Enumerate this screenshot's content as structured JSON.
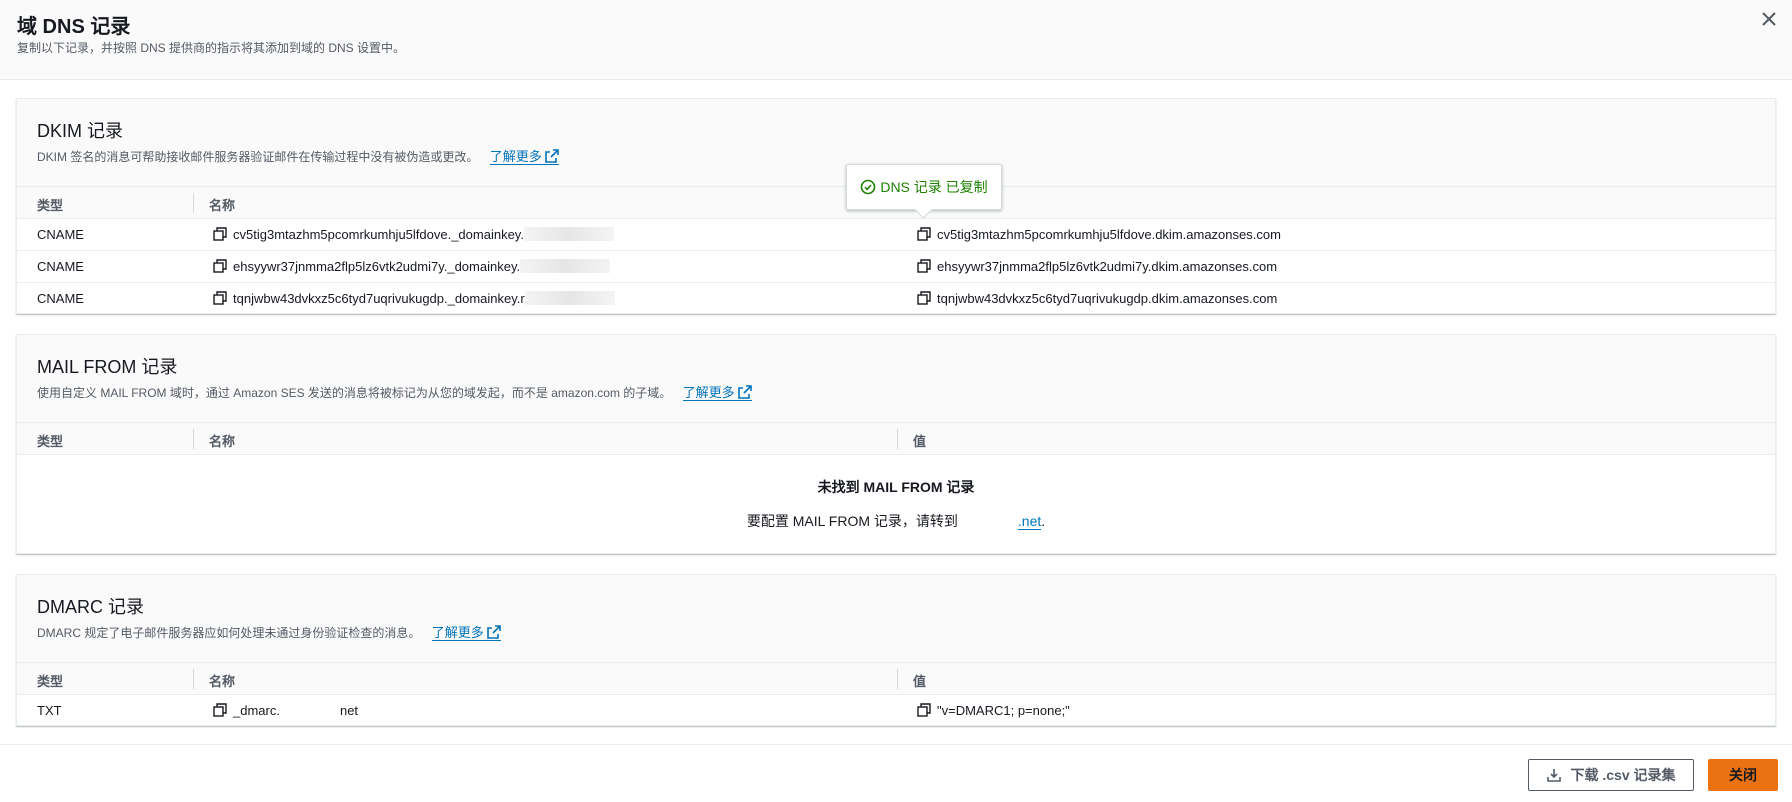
{
  "header": {
    "title": "域 DNS 记录",
    "subtitle": "复制以下记录，并按照 DNS 提供商的指示将其添加到域的 DNS 设置中。"
  },
  "icons": {
    "close": "close-icon",
    "copy": "copy-icon",
    "external": "external-link-icon",
    "success": "check-circle-icon",
    "download": "download-icon"
  },
  "colors": {
    "link": "#0073bb",
    "success": "#1d8102",
    "primary": "#ec7211"
  },
  "tooltip": {
    "text": "DNS 记录 已复制"
  },
  "dkim": {
    "title": "DKIM 记录",
    "description": "DKIM 签名的消息可帮助接收邮件服务器验证邮件在传输过程中没有被伪造或更改。",
    "learn_more": "了解更多",
    "columns": {
      "type": "类型",
      "name": "名称"
    },
    "rows": [
      {
        "type": "CNAME",
        "name": "cv5tig3mtazhm5pcomrkumhju5lfdove._domainkey.",
        "value": "cv5tig3mtazhm5pcomrkumhju5lfdove.dkim.amazonses.com"
      },
      {
        "type": "CNAME",
        "name": "ehsyywr37jnmma2flp5lz6vtk2udmi7y._domainkey.",
        "value": "ehsyywr37jnmma2flp5lz6vtk2udmi7y.dkim.amazonses.com"
      },
      {
        "type": "CNAME",
        "name": "tqnjwbw43dvkxz5c6tyd7uqrivukugdp._domainkey.r",
        "value": "tqnjwbw43dvkxz5c6tyd7uqrivukugdp.dkim.amazonses.com"
      }
    ]
  },
  "mailfrom": {
    "title": "MAIL FROM 记录",
    "description": "使用自定义 MAIL FROM 域时，通过 Amazon SES 发送的消息将被标记为从您的域发起，而不是 amazon.com 的子域。",
    "learn_more": "了解更多",
    "columns": {
      "type": "类型",
      "name": "名称",
      "value": "值"
    },
    "empty_title": "未找到 MAIL FROM 记录",
    "empty_desc": "要配置 MAIL FROM 记录，请转到",
    "empty_link": ".net",
    "empty_end": "."
  },
  "dmarc": {
    "title": "DMARC 记录",
    "description": "DMARC 规定了电子邮件服务器应如何处理未通过身份验证检查的消息。",
    "learn_more": "了解更多",
    "columns": {
      "type": "类型",
      "name": "名称",
      "value": "值"
    },
    "rows": [
      {
        "type": "TXT",
        "name_prefix": "_dmarc.",
        "name_suffix": "net",
        "value": "\"v=DMARC1; p=none;\""
      }
    ]
  },
  "footer": {
    "download_label": "下载 .csv 记录集",
    "close_label": "关闭"
  }
}
